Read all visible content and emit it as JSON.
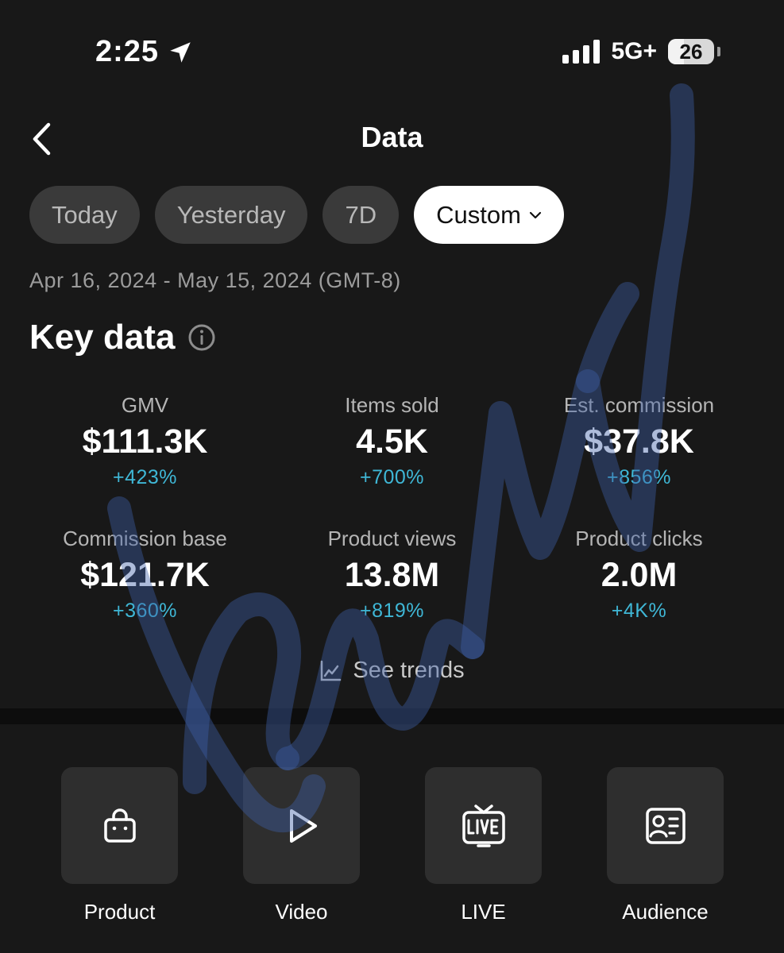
{
  "status_bar": {
    "time": "2:25",
    "network": "5G+",
    "battery": "26",
    "location_icon": "location-arrow-icon"
  },
  "header": {
    "title": "Data",
    "back_icon": "chevron-left-icon"
  },
  "filters": {
    "chips": [
      "Today",
      "Yesterday",
      "7D"
    ],
    "custom_label": "Custom",
    "selected": "Custom",
    "date_range": "Apr 16, 2024 - May 15, 2024 (GMT-8)"
  },
  "key_data": {
    "title": "Key data",
    "info_icon": "info-icon",
    "metrics": [
      {
        "label": "GMV",
        "value": "$111.3K",
        "change": "+423%"
      },
      {
        "label": "Items sold",
        "value": "4.5K",
        "change": "+700%"
      },
      {
        "label": "Est. commission",
        "value": "$37.8K",
        "change": "+856%"
      },
      {
        "label": "Commission base",
        "value": "$121.7K",
        "change": "+360%"
      },
      {
        "label": "Product views",
        "value": "13.8M",
        "change": "+819%"
      },
      {
        "label": "Product clicks",
        "value": "2.0M",
        "change": "+4K%"
      }
    ],
    "trends_label": "See trends",
    "trends_icon": "line-chart-icon"
  },
  "tiles": [
    {
      "label": "Product",
      "icon": "shopping-bag-icon"
    },
    {
      "label": "Video",
      "icon": "play-icon"
    },
    {
      "label": "LIVE",
      "icon": "live-tv-icon"
    },
    {
      "label": "Audience",
      "icon": "id-card-icon"
    }
  ],
  "colors": {
    "background": "#181818",
    "chip": "#3a3a3a",
    "chip_active": "#ffffff",
    "change_positive": "#3fb7d6",
    "tile": "#2e2e2e"
  }
}
